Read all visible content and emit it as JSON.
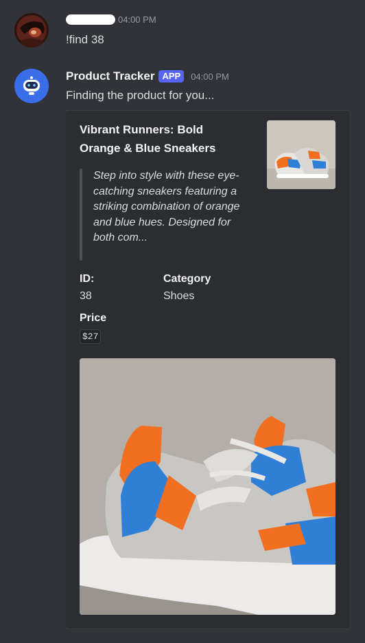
{
  "user_message": {
    "timestamp": "04:00 PM",
    "text": "!find 38"
  },
  "bot_message": {
    "name": "Product Tracker",
    "badge": "APP",
    "timestamp": "04:00 PM",
    "text": "Finding the product for you...",
    "embed": {
      "accent_color": "#3ba55d",
      "title": "Vibrant Runners: Bold Orange & Blue Sneakers",
      "description": "Step into style with these eye-catching sneakers featuring a striking combination of orange and blue hues. Designed for both com...",
      "fields": [
        {
          "name": "ID:",
          "value": "38"
        },
        {
          "name": "Category",
          "value": "Shoes"
        },
        {
          "name": "Price",
          "value": "$27"
        }
      ]
    }
  },
  "colors": {
    "background": "#313338",
    "embed_background": "#2b2d31",
    "badge": "#5865f2",
    "bot_avatar": "#3a6ee8"
  }
}
